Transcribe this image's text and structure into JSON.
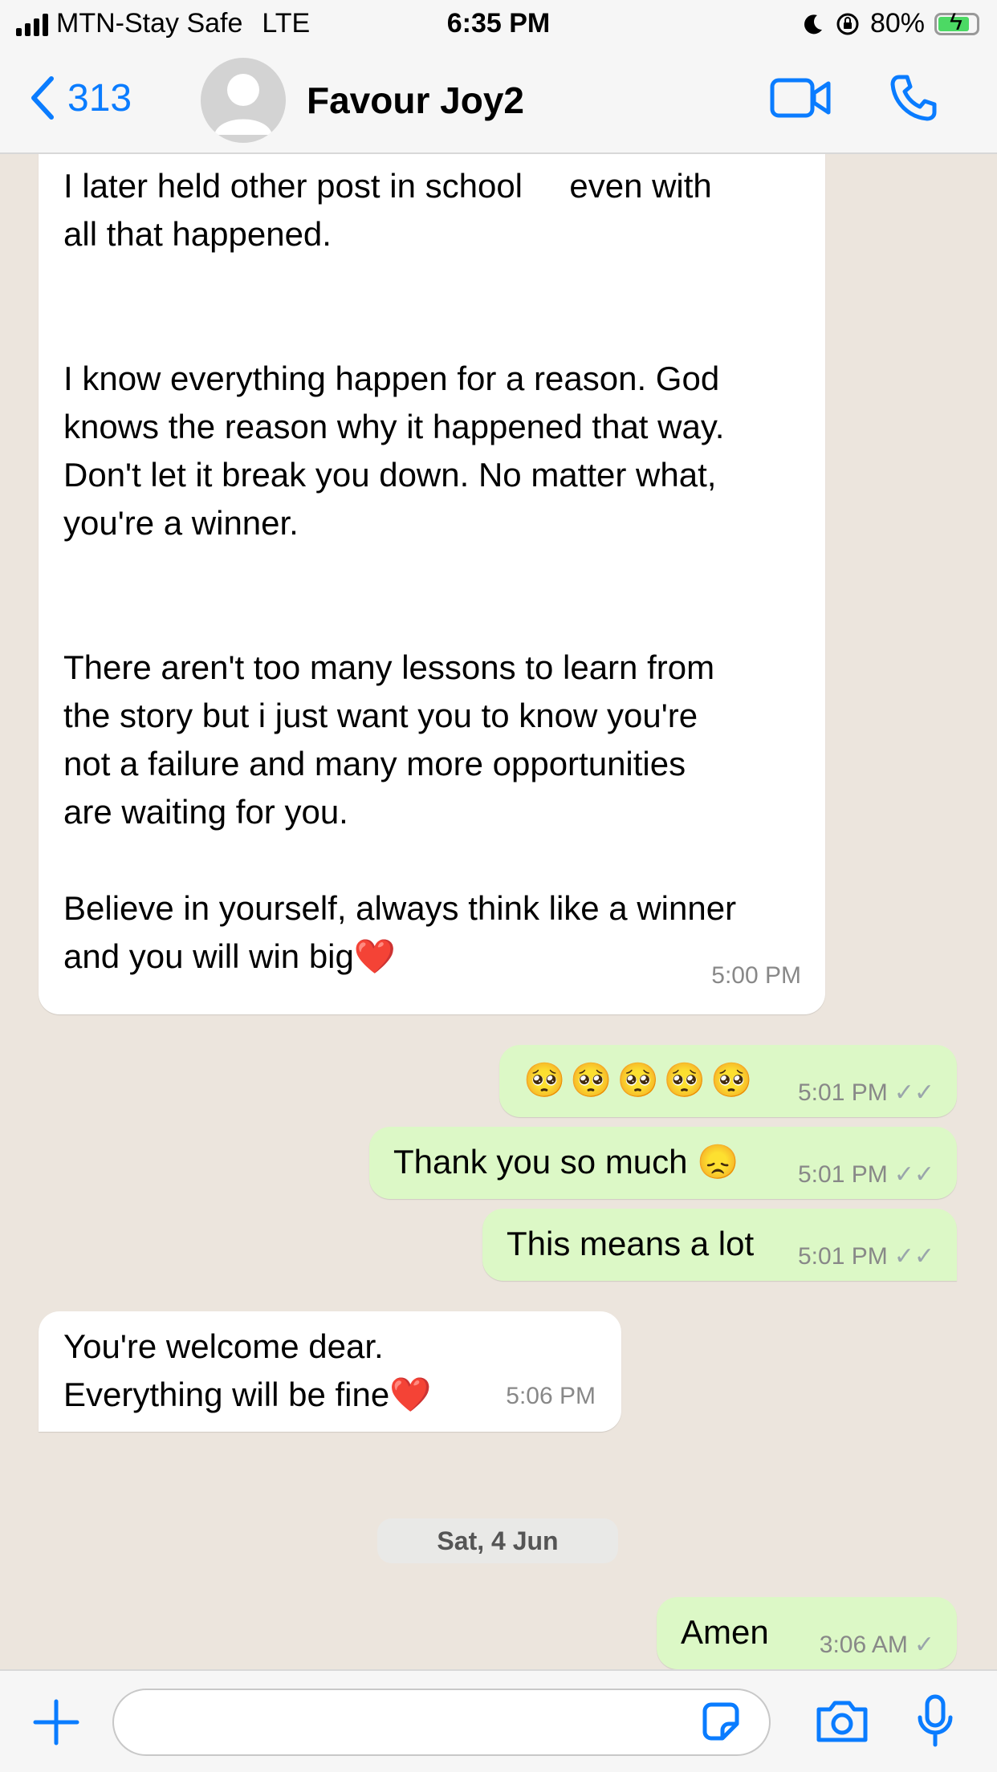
{
  "status": {
    "carrier": "MTN-Stay Safe",
    "network": "LTE",
    "time": "6:35 PM",
    "battery": "80%"
  },
  "header": {
    "back_count": "313",
    "contact_name": "Favour Joy2"
  },
  "colors": {
    "accent": "#0a7cff",
    "incoming_bubble": "#ffffff",
    "outgoing_bubble": "#dcf8c6",
    "chat_background": "#ece5dd"
  },
  "messages": [
    {
      "direction": "in",
      "text": "I later held other post in school     even with\nall that happened.\n\n\nI know everything happen for a reason. God\nknows the reason why it happened that way.\nDon't let it break you down. No matter what,\nyou're a winner.\n\n\nThere aren't too many lessons to learn from\nthe story but i just want you to know you're\nnot a failure and many more opportunities\nare waiting for you.\n\nBelieve in yourself, always think like a winner\nand you will win big❤️",
      "time": "5:00 PM"
    },
    {
      "direction": "out",
      "text": "🥺🥺🥺🥺🥺",
      "time": "5:01 PM"
    },
    {
      "direction": "out",
      "text": "Thank you so much 😞",
      "time": "5:01 PM"
    },
    {
      "direction": "out",
      "text": "This means a lot",
      "time": "5:01 PM"
    },
    {
      "direction": "in",
      "text": "You're welcome dear.\nEverything will be fine❤️",
      "time": "5:06 PM"
    },
    {
      "direction": "out",
      "text": "Amen",
      "time": "3:06 AM"
    }
  ],
  "date_separator": "Sat, 4 Jun",
  "input": {
    "placeholder": ""
  }
}
